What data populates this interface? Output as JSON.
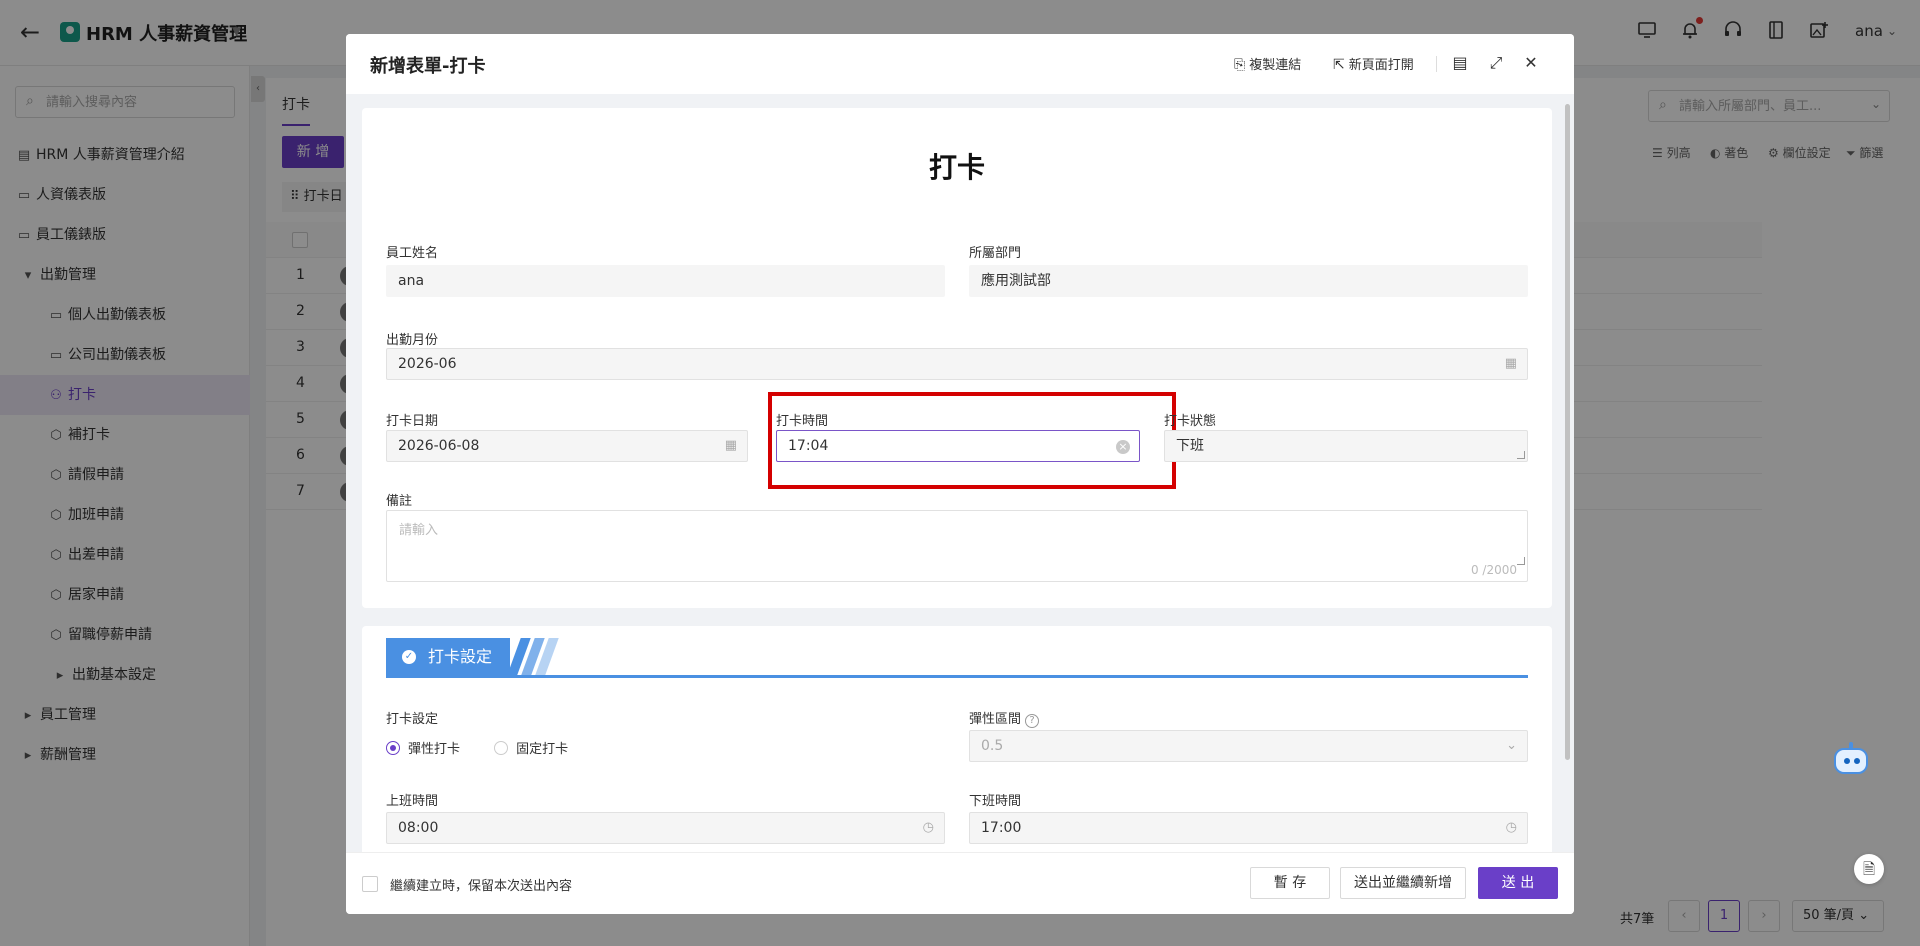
{
  "header": {
    "app_title": "HRM 人事薪資管理",
    "user_name": "ana"
  },
  "sidebar": {
    "search_placeholder": "請輸入搜尋內容",
    "items": [
      {
        "label": "HRM 人事薪資管理介紹",
        "icon": "table-icon"
      },
      {
        "label": "人資儀表版",
        "icon": "dashboard-icon"
      },
      {
        "label": "員工儀錶版",
        "icon": "dashboard-icon"
      },
      {
        "label": "出勤管理",
        "icon": "caret-down-icon"
      },
      {
        "label": "個人出勤儀表板",
        "icon": "dashboard-icon"
      },
      {
        "label": "公司出勤儀表板",
        "icon": "dashboard-icon"
      },
      {
        "label": "打卡",
        "icon": "user-icon"
      },
      {
        "label": "補打卡",
        "icon": "cube-icon"
      },
      {
        "label": "請假申請",
        "icon": "cube-icon"
      },
      {
        "label": "加班申請",
        "icon": "cube-icon"
      },
      {
        "label": "出差申請",
        "icon": "cube-icon"
      },
      {
        "label": "居家申請",
        "icon": "cube-icon"
      },
      {
        "label": "留職停薪申請",
        "icon": "cube-icon"
      },
      {
        "label": "出勤基本設定",
        "icon": "caret-right-icon"
      },
      {
        "label": "員工管理",
        "icon": "caret-right-icon"
      },
      {
        "label": "薪酬管理",
        "icon": "caret-right-icon"
      }
    ]
  },
  "main": {
    "tab": "打卡",
    "add_button": "新 增",
    "search_placeholder": "請輸入所屬部門、員工...",
    "toolbar": [
      "列高",
      "著色",
      "欄位設定",
      "篩選"
    ],
    "filter_chip": "打卡日",
    "rows": [
      "1",
      "2",
      "3",
      "4",
      "5",
      "6",
      "7"
    ],
    "pager": {
      "total": "共7筆",
      "page": "1",
      "size": "50 筆/頁"
    }
  },
  "modal": {
    "title": "新增表單-打卡",
    "copy_link": "複製連結",
    "open_new_page": "新頁面打開",
    "form_title": "打卡",
    "fields": {
      "employee_name": {
        "label": "員工姓名",
        "value": "ana"
      },
      "department": {
        "label": "所屬部門",
        "value": "應用測試部"
      },
      "month": {
        "label": "出勤月份",
        "value": "2026-06"
      },
      "punch_date": {
        "label": "打卡日期",
        "value": "2026-06-08"
      },
      "punch_time": {
        "label": "打卡時間",
        "value": "17:04"
      },
      "punch_status": {
        "label": "打卡狀態",
        "value": "下班"
      },
      "remarks": {
        "label": "備註",
        "placeholder": "請輸入",
        "count": "0 /2000"
      }
    },
    "section": {
      "title": "打卡設定",
      "setting_label": "打卡設定",
      "options": [
        "彈性打卡",
        "固定打卡"
      ],
      "selected": "彈性打卡",
      "flex_label": "彈性區間",
      "flex_value": "0.5",
      "start_label": "上班時間",
      "start_value": "08:00",
      "end_label": "下班時間",
      "end_value": "17:00"
    },
    "footer": {
      "keep_text": "繼續建立時，保留本次送出內容",
      "draft": "暫 存",
      "submit_continue": "送出並繼續新增",
      "submit": "送 出"
    }
  }
}
